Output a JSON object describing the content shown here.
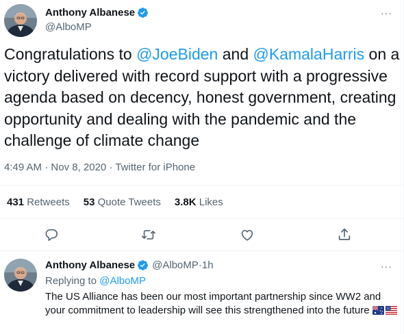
{
  "main_tweet": {
    "display_name": "Anthony Albanese",
    "handle": "@AlboMP",
    "more_label": "···",
    "text_prefix": "Congratulations to ",
    "mention_1": "@JoeBiden",
    "text_and": " and ",
    "mention_2": "@KamalaHarris",
    "text_suffix": " on a victory delivered with record support with a progressive agenda based on decency, honest government, creating opportunity and dealing with the pandemic and the challenge of climate change",
    "time": "4:49 AM",
    "date": "Nov 8, 2020",
    "separator": " · ",
    "source": "Twitter for iPhone",
    "stats": {
      "retweets_count": "431",
      "retweets_label": "Retweets",
      "quotes_count": "53",
      "quotes_label": "Quote Tweets",
      "likes_count": "3.8K",
      "likes_label": "Likes"
    },
    "actions": [
      "reply-icon",
      "retweet-icon",
      "like-icon",
      "share-icon"
    ]
  },
  "reply_tweet": {
    "display_name": "Anthony Albanese",
    "handle": "@AlboMP",
    "dot": " · ",
    "age": "1h",
    "more_label": "···",
    "replying_prefix": "Replying to ",
    "replying_handle": "@AlboMP",
    "text": "The US Alliance has been our most important partnership since WW2 and your commitment to leadership will see this strengthened into the future",
    "flags": [
      "australia-flag",
      "usa-flag"
    ]
  },
  "colors": {
    "accent": "#1d9bf0",
    "text": "#0f1419",
    "muted": "#536471",
    "divider": "#eff3f4",
    "verified": "#1d9bf0"
  }
}
